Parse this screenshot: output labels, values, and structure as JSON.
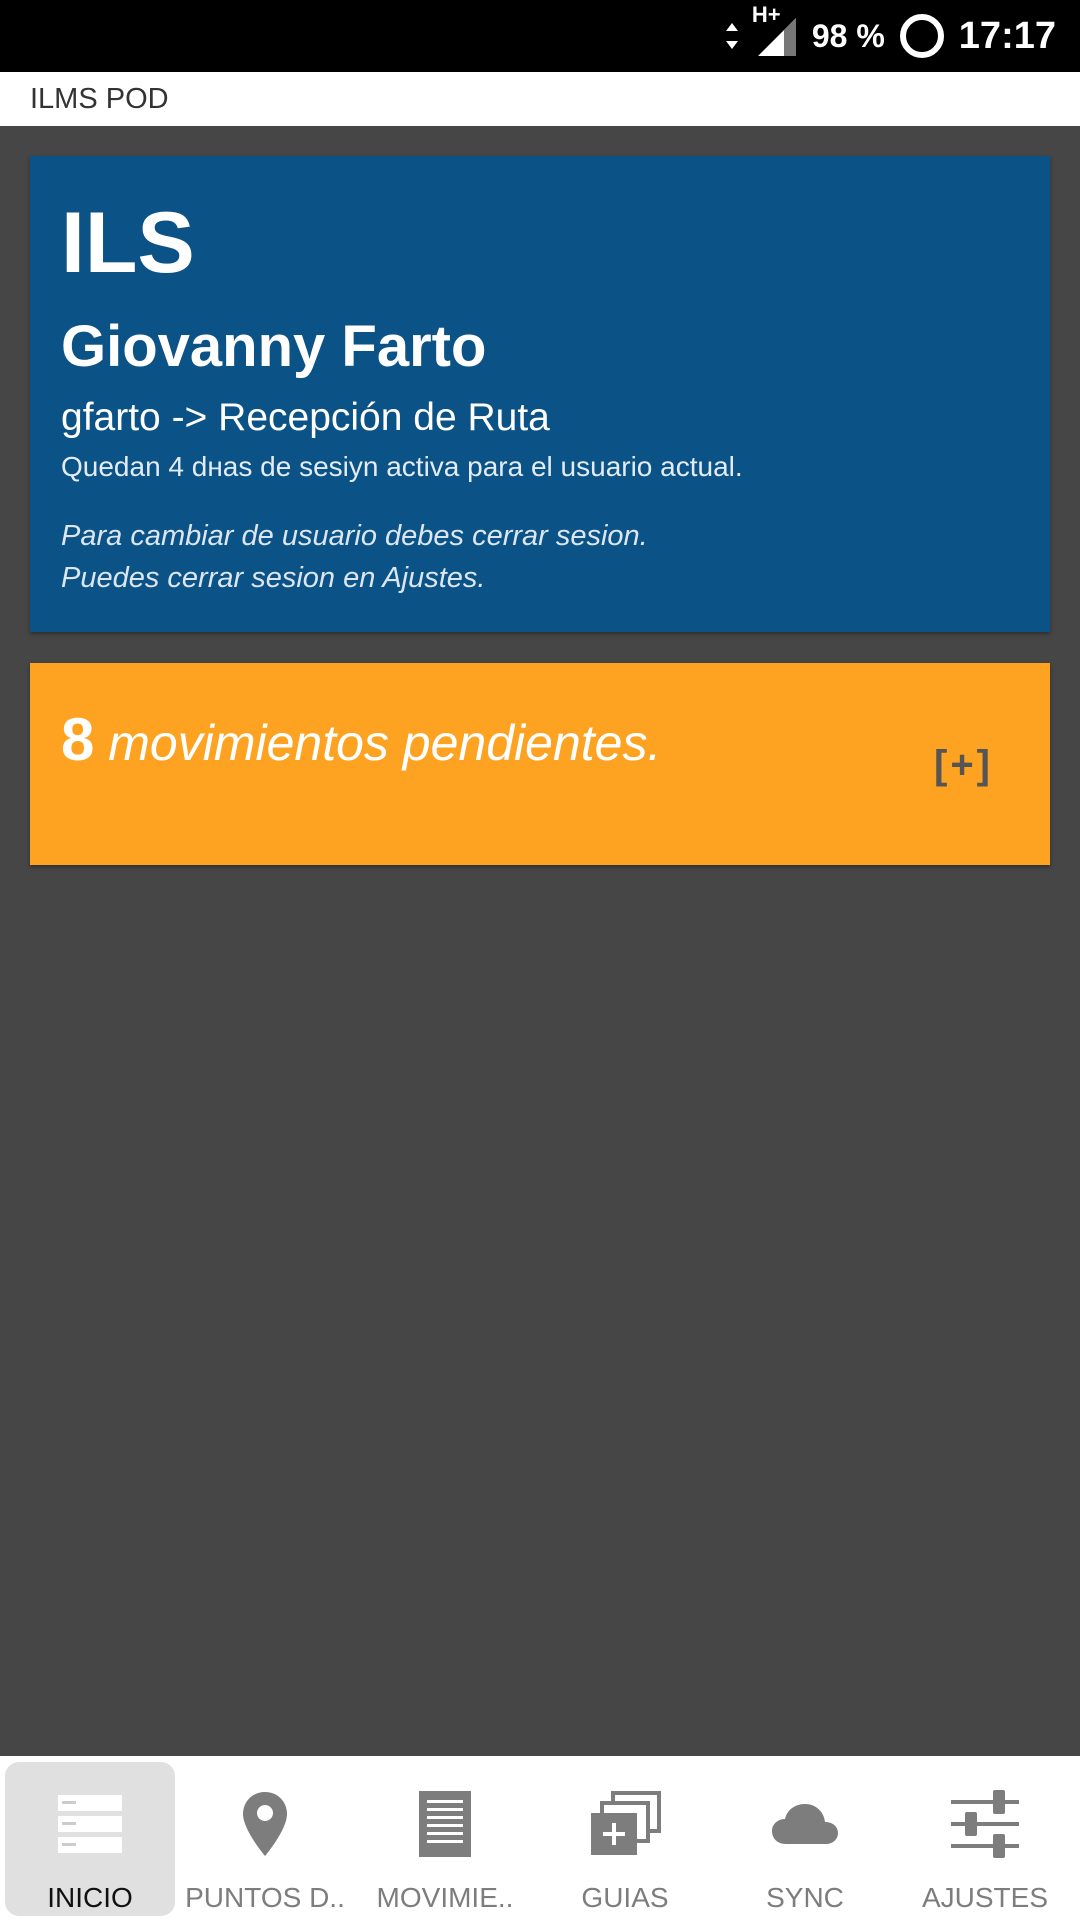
{
  "statusbar": {
    "network": "H+",
    "battery": "98 %",
    "time": "17:17"
  },
  "appbar": {
    "title": "ILMS POD"
  },
  "user_card": {
    "company": "ILS",
    "name": "Giovanny Farto",
    "role": "gfarto -> Recepción de Ruta",
    "session": "Quedan 4 dнas de sesiyn activa para el usuario actual.",
    "note_line1": "Para cambiar de usuario debes cerrar sesion.",
    "note_line2": "Puedes cerrar sesion en Ajustes."
  },
  "pending_card": {
    "count": "8",
    "text": " movimientos pendientes.",
    "expand": "[+]"
  },
  "bottom_nav": {
    "items": [
      {
        "label": "INICIO",
        "icon": "home-list-icon",
        "active": true
      },
      {
        "label": "PUNTOS D..",
        "icon": "map-pin-icon",
        "active": false
      },
      {
        "label": "MOVIMIE..",
        "icon": "document-icon",
        "active": false
      },
      {
        "label": "GUIAS",
        "icon": "add-stack-icon",
        "active": false
      },
      {
        "label": "SYNC",
        "icon": "cloud-icon",
        "active": false
      },
      {
        "label": "AJUSTES",
        "icon": "sliders-icon",
        "active": false
      }
    ]
  },
  "colors": {
    "user_card_bg": "#0b5286",
    "pending_card_bg": "#fea321",
    "content_bg": "#464646",
    "nav_icon": "#7d7d7d"
  }
}
